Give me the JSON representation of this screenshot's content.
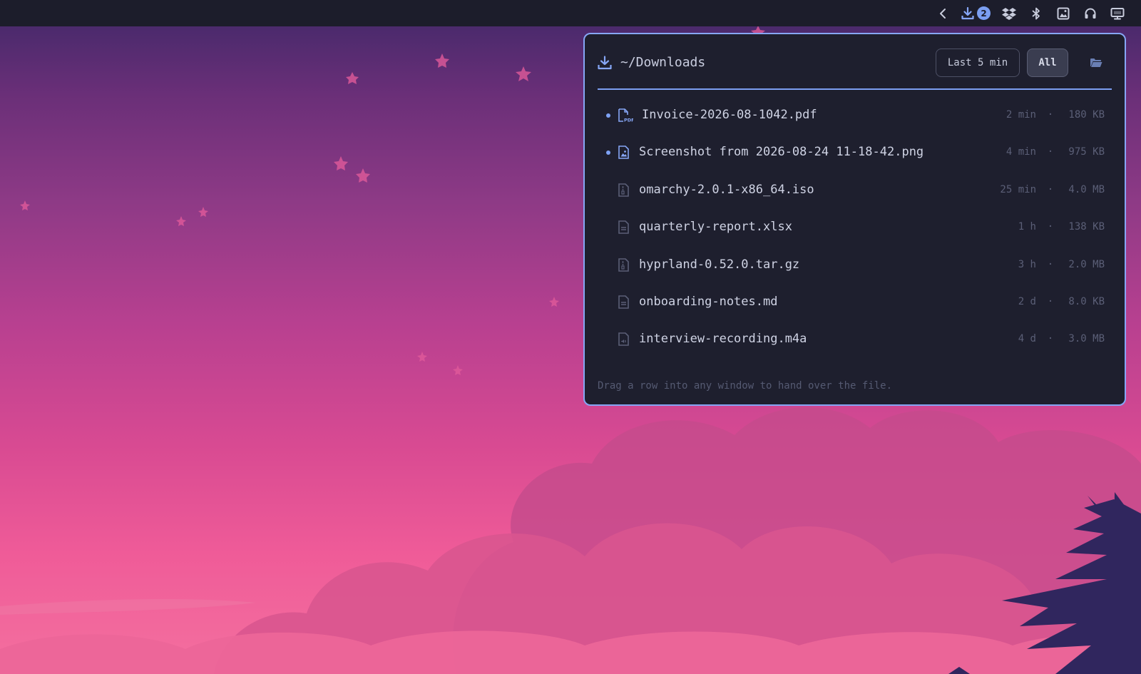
{
  "topbar": {
    "icons": [
      "back-chevron-icon",
      "download-icon",
      "dropbox-icon",
      "bluetooth-icon",
      "image-icon",
      "headphones-icon",
      "display-icon"
    ],
    "download_badge": "2"
  },
  "panel": {
    "title": "~/Downloads",
    "filters": {
      "last": "Last 5 min",
      "all": "All",
      "active": "All"
    },
    "accent": "#86a6f5",
    "files": [
      {
        "name": "Invoice-2026-08-1042.pdf",
        "age": "2 min",
        "size": "180 KB",
        "icon": "pdf-file-icon",
        "new": true
      },
      {
        "name": "Screenshot from 2026-08-24 11-18-42.png",
        "age": "4 min",
        "size": "975 KB",
        "icon": "image-file-icon",
        "new": true
      },
      {
        "name": "omarchy-2.0.1-x86_64.iso",
        "age": "25 min",
        "size": "4.0 MB",
        "icon": "archive-file-icon",
        "new": false
      },
      {
        "name": "quarterly-report.xlsx",
        "age": "1 h",
        "size": "138 KB",
        "icon": "document-file-icon",
        "new": false
      },
      {
        "name": "hyprland-0.52.0.tar.gz",
        "age": "3 h",
        "size": "2.0 MB",
        "icon": "archive-file-icon",
        "new": false
      },
      {
        "name": "onboarding-notes.md",
        "age": "2 d",
        "size": "8.0 KB",
        "icon": "document-file-icon",
        "new": false
      },
      {
        "name": "interview-recording.m4a",
        "age": "4 d",
        "size": "3.0 MB",
        "icon": "audio-file-icon",
        "new": false
      }
    ],
    "separator": "·",
    "footer": "Drag a row into any window to hand over the file."
  }
}
